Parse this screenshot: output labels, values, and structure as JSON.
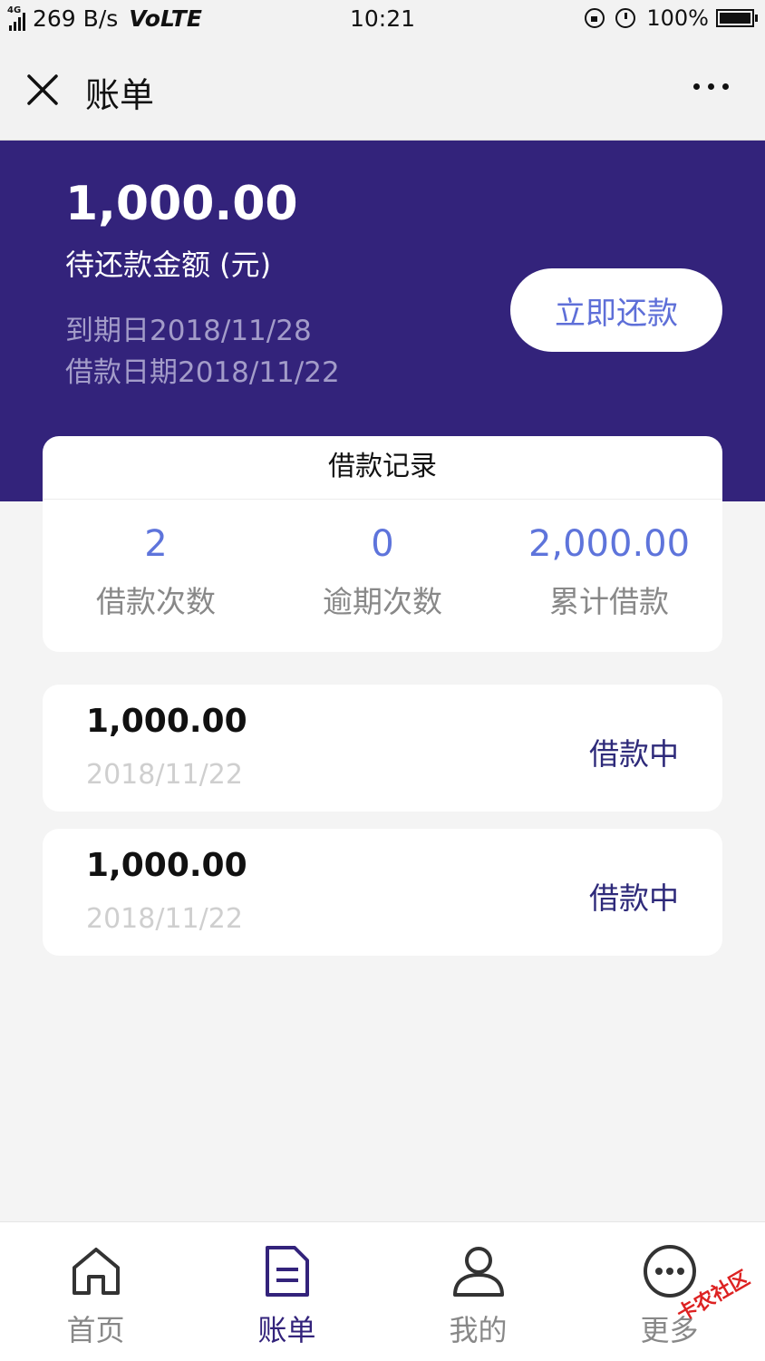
{
  "status_bar": {
    "network": "4G",
    "speed": "269 B/s",
    "volte": "VoLTE",
    "time": "10:21",
    "battery": "100%"
  },
  "nav": {
    "title": "账单",
    "close_icon": "close-icon",
    "more_icon": "more-icon"
  },
  "summary": {
    "amount": "1,000.00",
    "amount_label": "待还款金额 (元)",
    "due_date": "到期日2018/11/28",
    "loan_date": "借款日期2018/11/22",
    "repay_button": "立即还款"
  },
  "records": {
    "title": "借款记录",
    "stats": [
      {
        "value": "2",
        "label": "借款次数"
      },
      {
        "value": "0",
        "label": "逾期次数"
      },
      {
        "value": "2,000.00",
        "label": "累计借款"
      }
    ]
  },
  "loans": [
    {
      "amount": "1,000.00",
      "date": "2018/11/22",
      "status": "借款中"
    },
    {
      "amount": "1,000.00",
      "date": "2018/11/22",
      "status": "借款中"
    }
  ],
  "tabs": [
    {
      "label": "首页",
      "icon": "home-icon",
      "active": false
    },
    {
      "label": "账单",
      "icon": "bill-icon",
      "active": true
    },
    {
      "label": "我的",
      "icon": "user-icon",
      "active": false
    },
    {
      "label": "更多",
      "icon": "more-circle-icon",
      "active": false
    }
  ],
  "watermark": "卡农社区",
  "colors": {
    "primary": "#33237b",
    "accent": "#5e74db",
    "muted": "#888888"
  }
}
